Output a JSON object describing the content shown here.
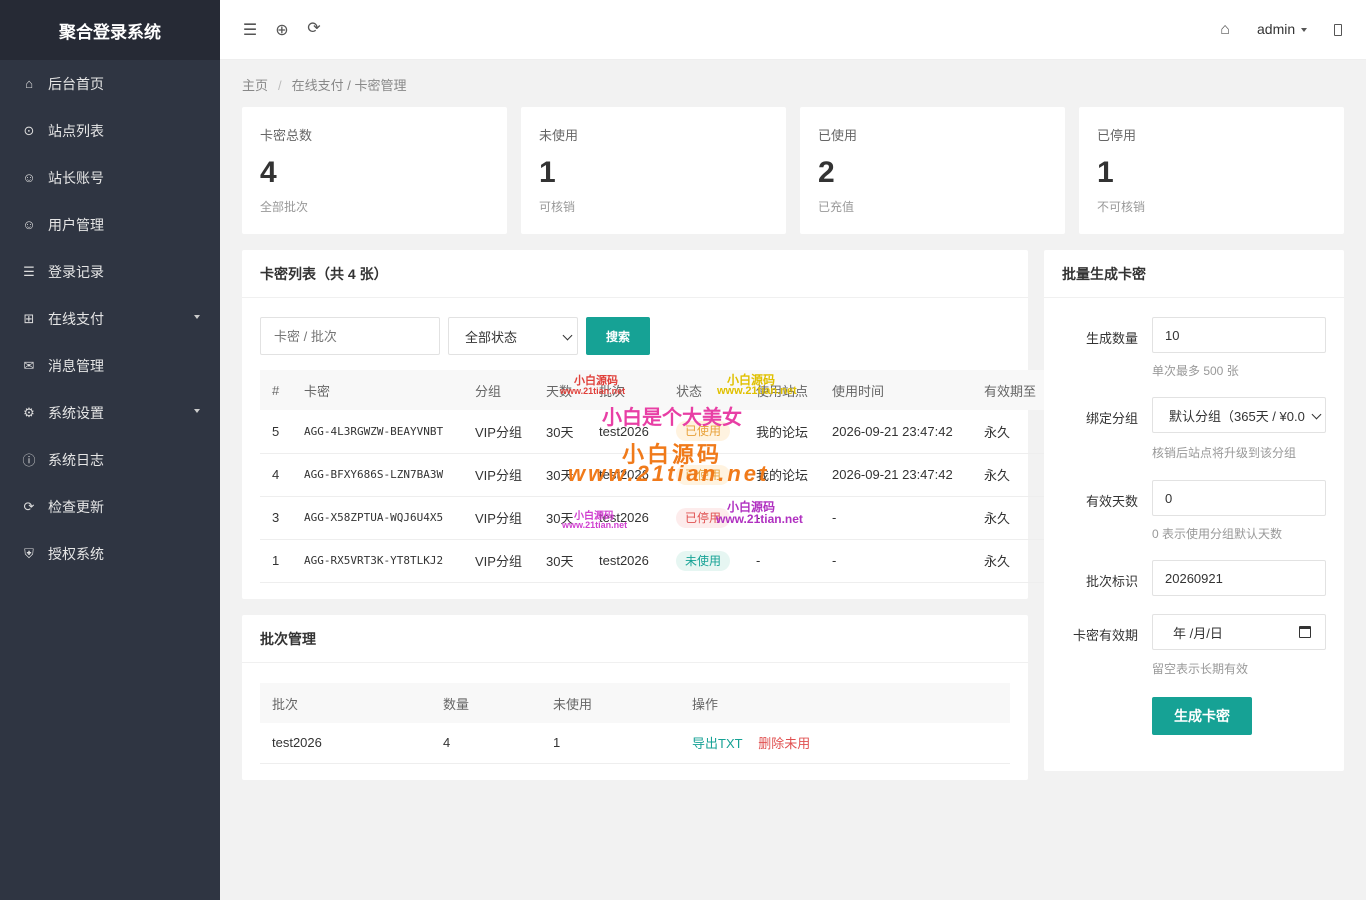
{
  "app": {
    "title": "聚合登录系统"
  },
  "sidebar": {
    "items": [
      {
        "label": "后台首页",
        "icon": "home-icon"
      },
      {
        "label": "站点列表",
        "icon": "circle-icon"
      },
      {
        "label": "站长账号",
        "icon": "smile-icon"
      },
      {
        "label": "用户管理",
        "icon": "smile-icon"
      },
      {
        "label": "登录记录",
        "icon": "list-icon"
      },
      {
        "label": "在线支付",
        "icon": "grid-icon"
      },
      {
        "label": "消息管理",
        "icon": "mail-icon"
      },
      {
        "label": "系统设置",
        "icon": "gear-icon"
      },
      {
        "label": "系统日志",
        "icon": "info-icon"
      },
      {
        "label": "检查更新",
        "icon": "refresh-icon"
      },
      {
        "label": "授权系统",
        "icon": "shield-icon"
      }
    ]
  },
  "header": {
    "username": "admin"
  },
  "breadcrumb": {
    "home": "主页",
    "path": "在线支付 / 卡密管理"
  },
  "stats": [
    {
      "label": "卡密总数",
      "value": "4",
      "sub": "全部批次"
    },
    {
      "label": "未使用",
      "value": "1",
      "sub": "可核销"
    },
    {
      "label": "已使用",
      "value": "2",
      "sub": "已充值"
    },
    {
      "label": "已停用",
      "value": "1",
      "sub": "不可核销"
    }
  ],
  "card_list": {
    "title": "卡密列表（共 4 张）",
    "search_placeholder": "卡密 / 批次",
    "status_filter": "全部状态",
    "search_button": "搜索",
    "columns": [
      "#",
      "卡密",
      "分组",
      "天数",
      "批次",
      "状态",
      "使用站点",
      "使用时间",
      "有效期至"
    ],
    "rows": [
      {
        "id": "5",
        "code": "AGG-4L3RGWZW-BEAYVNBT",
        "group": "VIP分组",
        "days": "30天",
        "batch": "test2026",
        "status": "已使用",
        "site": "我的论坛",
        "time": "2026-09-21 23:47:42",
        "expire": "永久"
      },
      {
        "id": "4",
        "code": "AGG-BFXY686S-LZN7BA3W",
        "group": "VIP分组",
        "days": "30天",
        "batch": "test2026",
        "status": "已使用",
        "site": "我的论坛",
        "time": "2026-09-21 23:47:42",
        "expire": "永久"
      },
      {
        "id": "3",
        "code": "AGG-X58ZPTUA-WQJ6U4X5",
        "group": "VIP分组",
        "days": "30天",
        "batch": "test2026",
        "status": "已停用",
        "site": "-",
        "time": "-",
        "expire": "永久"
      },
      {
        "id": "1",
        "code": "AGG-RX5VRT3K-YT8TLKJ2",
        "group": "VIP分组",
        "days": "30天",
        "batch": "test2026",
        "status": "未使用",
        "site": "-",
        "time": "-",
        "expire": "永久"
      }
    ]
  },
  "batch_mgmt": {
    "title": "批次管理",
    "columns": [
      "批次",
      "数量",
      "未使用",
      "操作"
    ],
    "rows": [
      {
        "batch": "test2026",
        "count": "4",
        "unused": "1",
        "export": "导出TXT",
        "delete": "删除未用"
      }
    ]
  },
  "generate": {
    "title": "批量生成卡密",
    "qty_label": "生成数量",
    "qty_value": "10",
    "qty_hint": "单次最多 500 张",
    "group_label": "绑定分组",
    "group_value": "默认分组（365天 / ¥0.0",
    "group_hint": "核销后站点将升级到该分组",
    "days_label": "有效天数",
    "days_value": "0",
    "days_hint": "0 表示使用分组默认天数",
    "batch_label": "批次标识",
    "batch_value": "20260921",
    "expire_label": "卡密有效期",
    "expire_value": "年 /月/日",
    "expire_hint": "留空表示长期有效",
    "submit": "生成卡密"
  },
  "watermarks": [
    "小白源码",
    "www.21tian.net",
    "小白是个大美女",
    "小白源码",
    "www.21tian.net",
    "小白源码",
    "www.21tian.net",
    "小白源码",
    "www.21tian.net"
  ]
}
